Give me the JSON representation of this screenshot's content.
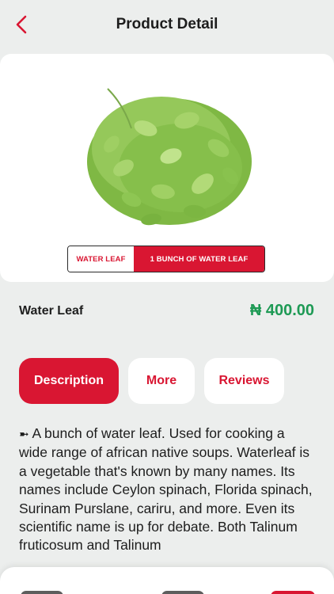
{
  "header": {
    "title": "Product Detail",
    "back_icon": "chevron-left-icon"
  },
  "product": {
    "name": "Water Leaf",
    "price": "₦ 400.00",
    "variants": [
      "WATER LEAF",
      "1 BUNCH OF WATER LEAF"
    ],
    "selected_variant_index": 1
  },
  "tabs": [
    {
      "label": "Description",
      "active": true
    },
    {
      "label": "More",
      "active": false
    },
    {
      "label": "Reviews",
      "active": false
    }
  ],
  "description": {
    "bullet": "➼",
    "text": "A bunch of water leaf. Used for cooking a wide range of african native soups. Waterleaf is a vegetable that's known by many names. Its names include Ceylon spinach, Florida spinach, Surinam Purslane, cariru, and more. Even its scientific name is up for debate. Both Talinum fruticosum and Talinum"
  },
  "colors": {
    "accent": "#d91632",
    "price": "#1e9a55",
    "background": "#eceeed"
  }
}
